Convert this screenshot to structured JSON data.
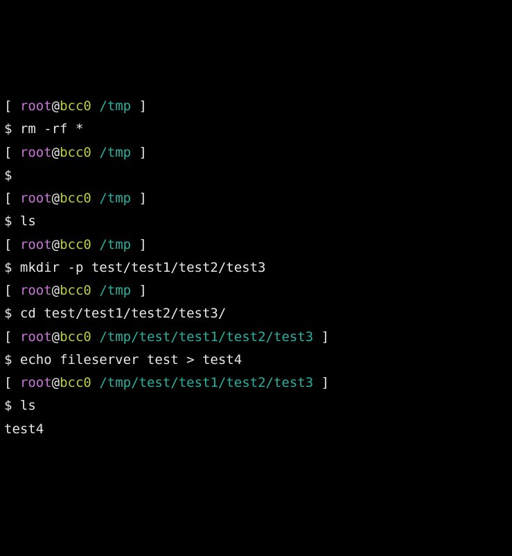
{
  "prompt_parts": {
    "open": "[ ",
    "at": "@",
    "sep": " ",
    "close": " ]",
    "dollar": "$ "
  },
  "lines": [
    {
      "type": "prompt",
      "user": "root",
      "host": "bcc0",
      "path": "/tmp"
    },
    {
      "type": "cmd",
      "text": "rm -rf *"
    },
    {
      "type": "prompt",
      "user": "root",
      "host": "bcc0",
      "path": "/tmp"
    },
    {
      "type": "cmd",
      "text": ""
    },
    {
      "type": "prompt",
      "user": "root",
      "host": "bcc0",
      "path": "/tmp"
    },
    {
      "type": "cmd",
      "text": "ls"
    },
    {
      "type": "prompt",
      "user": "root",
      "host": "bcc0",
      "path": "/tmp"
    },
    {
      "type": "cmd",
      "text": "mkdir -p test/test1/test2/test3"
    },
    {
      "type": "prompt",
      "user": "root",
      "host": "bcc0",
      "path": "/tmp"
    },
    {
      "type": "cmd",
      "text": "cd test/test1/test2/test3/"
    },
    {
      "type": "prompt",
      "user": "root",
      "host": "bcc0",
      "path": "/tmp/test/test1/test2/test3"
    },
    {
      "type": "cmd",
      "text": "echo fileserver test > test4"
    },
    {
      "type": "prompt",
      "user": "root",
      "host": "bcc0",
      "path": "/tmp/test/test1/test2/test3"
    },
    {
      "type": "cmd",
      "text": "ls"
    },
    {
      "type": "output",
      "text": "test4"
    }
  ]
}
